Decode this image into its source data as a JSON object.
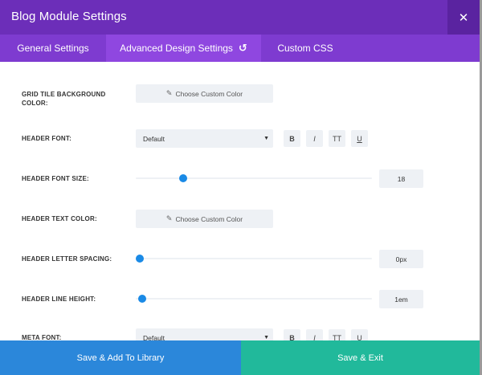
{
  "window": {
    "title": "Blog Module Settings",
    "close_symbol": "✕"
  },
  "tabs": [
    {
      "label": "General Settings"
    },
    {
      "label": "Advanced Design Settings",
      "undo_symbol": "↺"
    },
    {
      "label": "Custom CSS"
    }
  ],
  "fields": {
    "grid_tile_bg": {
      "label": "GRID TILE BACKGROUND COLOR:",
      "button": "Choose Custom Color"
    },
    "header_font": {
      "label": "HEADER FONT:",
      "value": "Default",
      "bold": "B",
      "italic": "I",
      "caps": "TT",
      "underline": "U"
    },
    "header_font_size": {
      "label": "HEADER FONT SIZE:",
      "value": "18",
      "slider_fraction": 0.19
    },
    "header_text_color": {
      "label": "HEADER TEXT COLOR:",
      "button": "Choose Custom Color"
    },
    "header_letter_spacing": {
      "label": "HEADER LETTER SPACING:",
      "value": "0px",
      "slider_fraction": 0.0
    },
    "header_line_height": {
      "label": "HEADER LINE HEIGHT:",
      "value": "1em",
      "slider_fraction": 0.01
    },
    "meta_font": {
      "label": "META FONT:",
      "value": "Default",
      "bold": "B",
      "italic": "I",
      "caps": "TT",
      "underline": "U"
    }
  },
  "footer": {
    "library_label": "Save & Add To Library",
    "exit_label": "Save & Exit"
  },
  "icons": {
    "eyedropper": "eyedropper-icon",
    "caret": "caret-down-icon",
    "undo": "undo-icon",
    "close": "close-icon"
  },
  "colors": {
    "title_bar": "#6c2eb9",
    "tabs_bar": "#7e3bd0",
    "active_tab": "#8f47e0",
    "accent": "#1a8ae6",
    "library_button": "#2b87da",
    "exit_button": "#21b99b"
  }
}
